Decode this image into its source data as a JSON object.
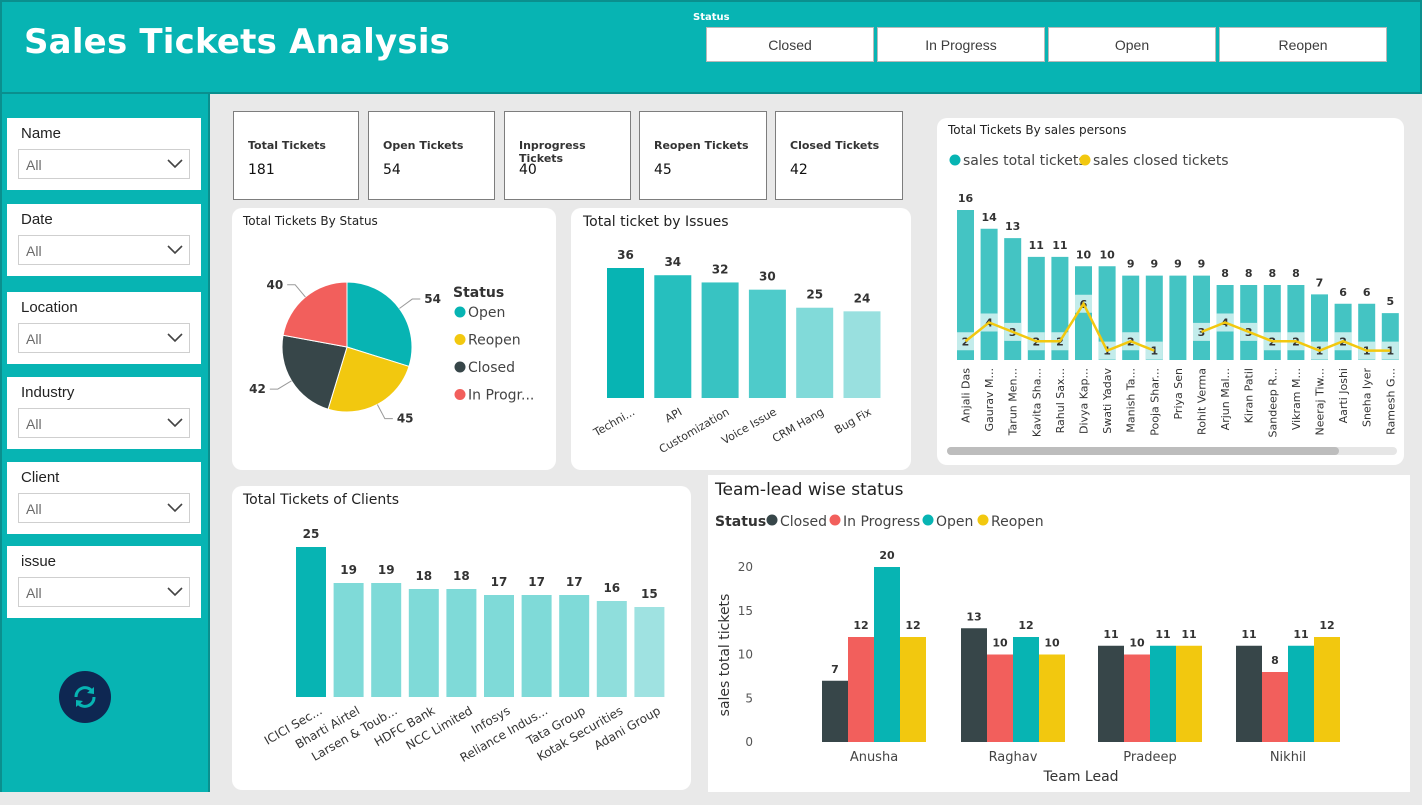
{
  "header": {
    "title": "Sales Tickets Analysis",
    "status_caption": "Status",
    "status_buttons": [
      "Closed",
      "In Progress",
      "Open",
      "Reopen"
    ]
  },
  "sidebar": {
    "slicers": [
      {
        "label": "Name",
        "value": "All"
      },
      {
        "label": "Date",
        "value": "All"
      },
      {
        "label": "Location",
        "value": "All"
      },
      {
        "label": "Industry",
        "value": "All"
      },
      {
        "label": "Client",
        "value": "All"
      },
      {
        "label": "issue",
        "value": "All"
      }
    ],
    "refresh_icon": "refresh-icon"
  },
  "kpis": [
    {
      "label": "Total Tickets",
      "value": "181"
    },
    {
      "label": "Open Tickets",
      "value": "54"
    },
    {
      "label": "Inprogress Tickets",
      "value": "40"
    },
    {
      "label": "Reopen Tickets",
      "value": "45"
    },
    {
      "label": "Closed Tickets",
      "value": "42"
    }
  ],
  "colors": {
    "teal": "#07b4b3",
    "yellow": "#f2c80f",
    "dark": "#374649",
    "red": "#f25f5c",
    "navy": "#0e2752"
  },
  "chart_data": [
    {
      "type": "pie",
      "title": "Total Tickets By Status",
      "legend_title": "Status",
      "legend_placement": "right",
      "categories": [
        "Open",
        "Reopen",
        "Closed",
        "In Progr..."
      ],
      "values": [
        54,
        45,
        42,
        40
      ],
      "colors": [
        "#07b4b3",
        "#f2c80f",
        "#374649",
        "#f25f5c"
      ]
    },
    {
      "type": "bar",
      "title": "Total ticket by Issues",
      "categories": [
        "Techni...",
        "API",
        "Customization",
        "Voice Issue",
        "CRM Hang",
        "Bug Fix"
      ],
      "values": [
        36,
        34,
        32,
        30,
        25,
        24
      ]
    },
    {
      "type": "bar",
      "title": "Total Tickets By sales persons",
      "legend_placement": "top-left",
      "categories": [
        "Anjali Das",
        "Gaurav M...",
        "Tarun Men...",
        "Kavita Sha...",
        "Rahul Sax...",
        "Divya Kap...",
        "Swati Yadav",
        "Manish Ta...",
        "Pooja Shar...",
        "Priya Sen",
        "Rohit Verma",
        "Arjun Mal...",
        "Kiran Patil",
        "Sandeep R...",
        "Vikram M...",
        "Neeraj Tiw...",
        "Aarti Joshi",
        "Sneha Iyer",
        "Ramesh G..."
      ],
      "series": [
        {
          "name": "sales total tickets",
          "values": [
            16,
            14,
            13,
            11,
            11,
            10,
            10,
            9,
            9,
            9,
            9,
            8,
            8,
            8,
            8,
            7,
            6,
            6,
            5
          ]
        },
        {
          "name": "sales closed tickets",
          "values": [
            2,
            4,
            3,
            2,
            2,
            6,
            1,
            2,
            1,
            null,
            3,
            4,
            3,
            2,
            2,
            1,
            2,
            1,
            1
          ]
        }
      ],
      "series_types": [
        "bar",
        "line"
      ],
      "scrollbar": true
    },
    {
      "type": "bar",
      "title": "Total Tickets of Clients",
      "categories": [
        "ICICI Sec...",
        "Bharti Airtel",
        "Larsen & Toub...",
        "HDFC Bank",
        "NCC Limited",
        "Infosys",
        "Reliance Indus...",
        "Tata Group",
        "Kotak Securities",
        "Adani Group"
      ],
      "values": [
        25,
        19,
        19,
        18,
        18,
        17,
        17,
        17,
        16,
        15
      ]
    },
    {
      "type": "bar",
      "title": "Team-lead wise status",
      "legend_title": "Status",
      "legend_placement": "top-left",
      "categories": [
        "Anusha",
        "Raghav",
        "Pradeep",
        "Nikhil"
      ],
      "series": [
        {
          "name": "Closed",
          "values": [
            7,
            13,
            11,
            11
          ],
          "color": "#374649"
        },
        {
          "name": "In Progress",
          "values": [
            12,
            10,
            10,
            8
          ],
          "color": "#f25f5c"
        },
        {
          "name": "Open",
          "values": [
            20,
            12,
            11,
            11
          ],
          "color": "#07b4b3"
        },
        {
          "name": "Reopen",
          "values": [
            12,
            10,
            11,
            12
          ],
          "color": "#f2c80f"
        }
      ],
      "xlabel": "Team Lead",
      "ylabel": "sales total tickets",
      "ylim": [
        0,
        20
      ],
      "yticks": [
        "0",
        "5",
        "10",
        "15",
        "20"
      ],
      "grid": false
    }
  ]
}
